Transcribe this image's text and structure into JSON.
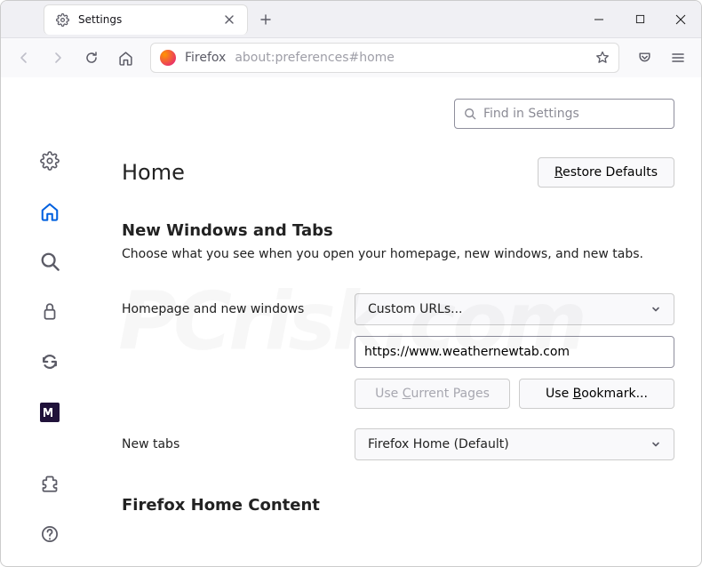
{
  "tab": {
    "title": "Settings"
  },
  "url": {
    "label": "Firefox",
    "path": "about:preferences#home"
  },
  "search": {
    "placeholder": "Find in Settings"
  },
  "page": {
    "title": "Home",
    "restore": "Restore Defaults",
    "section1_title": "New Windows and Tabs",
    "section1_desc": "Choose what you see when you open your homepage, new windows, and new tabs.",
    "homepage_label": "Homepage and new windows",
    "homepage_select": "Custom URLs...",
    "homepage_value": "https://www.weathernewtab.com",
    "use_current": "Use Current Pages",
    "use_bookmark": "Use Bookmark...",
    "newtabs_label": "New tabs",
    "newtabs_select": "Firefox Home (Default)",
    "section2_title": "Firefox Home Content"
  },
  "watermark": "PCrisk.com"
}
